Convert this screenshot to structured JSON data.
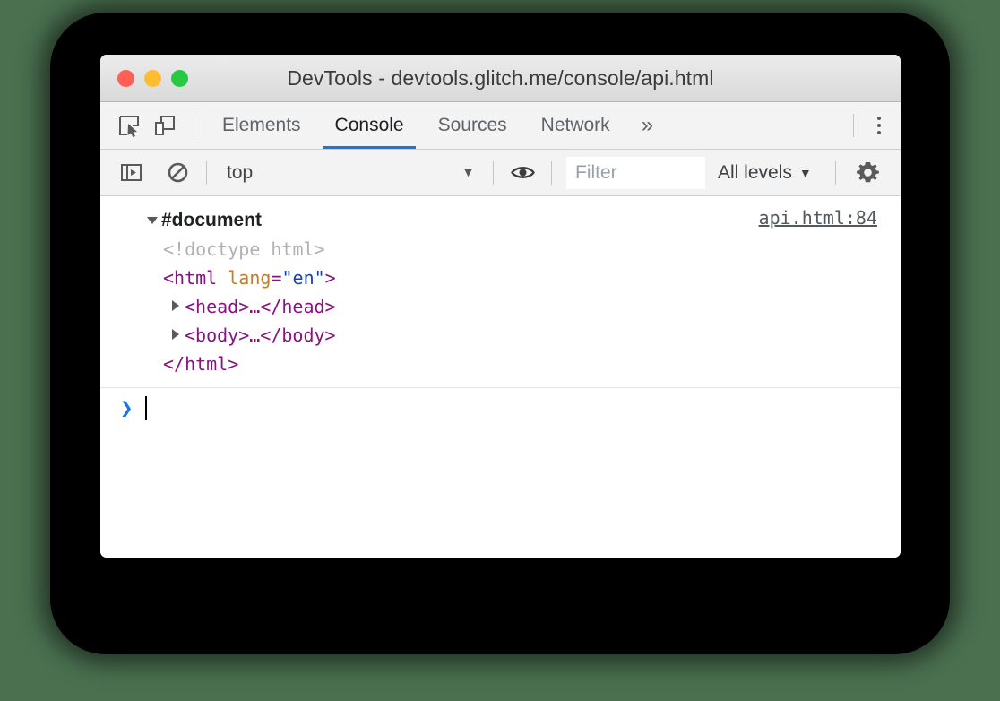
{
  "window": {
    "title": "DevTools - devtools.glitch.me/console/api.html",
    "traffic_lights": [
      {
        "name": "close",
        "color": "#ff5f57"
      },
      {
        "name": "minimize",
        "color": "#febc2e"
      },
      {
        "name": "zoom",
        "color": "#28c840"
      }
    ]
  },
  "tabbar": {
    "icons": [
      {
        "name": "inspect-element-icon",
        "label": "Inspect element"
      },
      {
        "name": "device-toolbar-icon",
        "label": "Toggle device toolbar"
      }
    ],
    "tabs": [
      {
        "label": "Elements",
        "active": false
      },
      {
        "label": "Console",
        "active": true
      },
      {
        "label": "Sources",
        "active": false
      },
      {
        "label": "Network",
        "active": false
      }
    ],
    "more_label": "»",
    "menu_label": "Customize and control DevTools"
  },
  "console_toolbar": {
    "sidebar_toggle_label": "Show console sidebar",
    "clear_label": "Clear console",
    "context": {
      "value": "top",
      "caret": "▼"
    },
    "eye_label": "Create live expression",
    "filter": {
      "value": "",
      "placeholder": "Filter"
    },
    "levels": {
      "label": "All levels",
      "caret": "▼"
    },
    "settings_label": "Console settings"
  },
  "console": {
    "source_link": "api.html:84",
    "dom": {
      "root_label": "#document",
      "lines": [
        {
          "indent": 1,
          "text": "<!doctype html>",
          "kind": "doctype"
        },
        {
          "indent": 1,
          "text": "<html lang=\"en\">",
          "kind": "open-tag"
        },
        {
          "indent": 2,
          "text": "<head>…</head>",
          "kind": "collapsed",
          "expandable": true
        },
        {
          "indent": 2,
          "text": "<body>…</body>",
          "kind": "collapsed",
          "expandable": true
        },
        {
          "indent": 1,
          "text": "</html>",
          "kind": "close-tag"
        }
      ],
      "html_tag_name": "html",
      "html_attr_name": "lang",
      "html_attr_value": "\"en\"",
      "head_tag": "head",
      "body_tag": "body",
      "ellipsis": "…"
    },
    "prompt": {
      "chevron": "❯",
      "value": ""
    }
  },
  "colors": {
    "page_background": "#4a7050",
    "panel_background": "#000000",
    "accent_blue": "#1a73e8",
    "tag_purple": "#881280",
    "attr_orange": "#c27c2c",
    "value_blue": "#1a3fb0",
    "comment_gray": "#b0b0b0"
  }
}
